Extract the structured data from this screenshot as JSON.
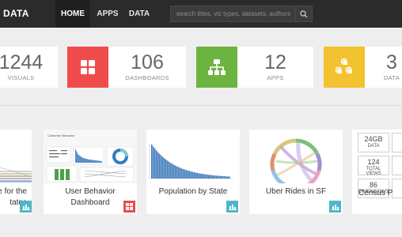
{
  "nav": {
    "brand": "DATA",
    "links": [
      {
        "label": "HOME",
        "active": true
      },
      {
        "label": "APPS",
        "active": false
      },
      {
        "label": "DATA",
        "active": false
      }
    ],
    "search_placeholder": "search titles, viz types, datasets, authors",
    "search_icon": "search-icon"
  },
  "stats": [
    {
      "value": "1244",
      "label": "VISUALS",
      "color": "#ffffff",
      "icon": "none"
    },
    {
      "value": "106",
      "label": "DASHBOARDS",
      "color": "#f04b4b",
      "icon": "grid-icon"
    },
    {
      "value": "12",
      "label": "APPS",
      "color": "#6db33f",
      "icon": "sitemap-icon"
    },
    {
      "value": "3",
      "label": "DATA",
      "color": "#f2c230",
      "icon": "cubes-icon"
    }
  ],
  "cards": [
    {
      "title_line1": "e for the",
      "title_line2": "tates",
      "badge_color": "#4fb6c8",
      "badge_icon": "bar-chart-icon"
    },
    {
      "title_line1": "User Behavior",
      "title_line2": "Dashboard",
      "badge_color": "#f04b4b",
      "badge_icon": "grid-icon",
      "thumb_heading": "Customer Behavior"
    },
    {
      "title_line1": "Population by State",
      "title_line2": "",
      "badge_color": "#4fb6c8",
      "badge_icon": "bar-chart-icon"
    },
    {
      "title_line1": "Uber Rides in SF",
      "title_line2": "",
      "badge_color": "#4fb6c8",
      "badge_icon": "bar-chart-icon"
    },
    {
      "title_line1": "Census P",
      "title_line2": "",
      "metrics": [
        {
          "value": "24GB",
          "label": "DATA"
        },
        {
          "value": "124",
          "label": "TOTAL VIEWS"
        },
        {
          "value": "86",
          "label": "DIMENSIONS"
        }
      ]
    }
  ]
}
